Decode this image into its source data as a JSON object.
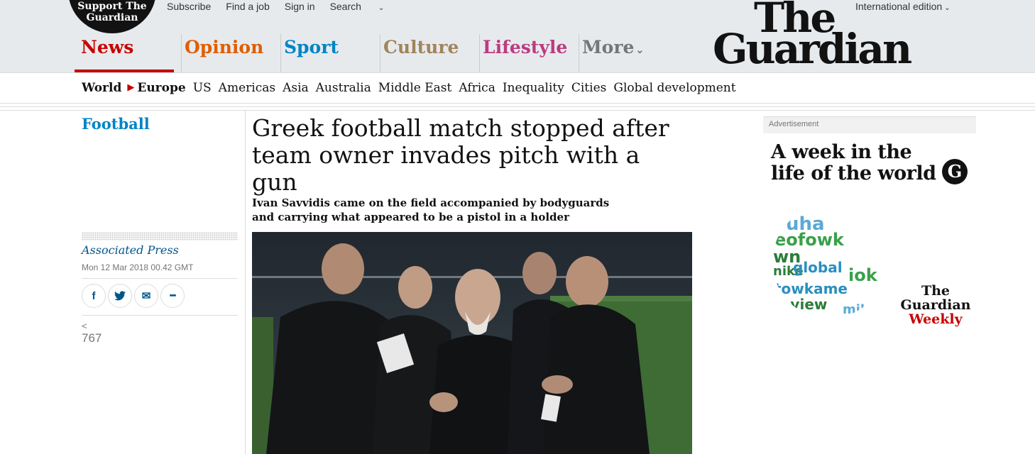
{
  "support": {
    "line1": "Support The",
    "line2": "Guardian"
  },
  "toplinks": [
    {
      "label": "Subscribe"
    },
    {
      "label": "Find a job"
    },
    {
      "label": "Sign in"
    },
    {
      "label": "Search"
    }
  ],
  "edition": "International edition",
  "logo": {
    "line1": "The",
    "line2": "Guardian"
  },
  "pillars": [
    {
      "label": "News",
      "color": "#c70000"
    },
    {
      "label": "Opinion",
      "color": "#e05e00"
    },
    {
      "label": "Sport",
      "color": "#0084c6"
    },
    {
      "label": "Culture",
      "color": "#a1845c"
    },
    {
      "label": "Lifestyle",
      "color": "#bb3b80"
    },
    {
      "label": "More",
      "color": "#767676"
    }
  ],
  "subnav": {
    "parent": "World",
    "current": "Europe",
    "items": [
      "US",
      "Americas",
      "Asia",
      "Australia",
      "Middle East",
      "Africa",
      "Inequality",
      "Cities",
      "Global development"
    ]
  },
  "article": {
    "section": "Football",
    "headline": "Greek football match stopped after team owner invades pitch with a gun",
    "standfirst": "Ivan Savvidis came on the field accompanied by bodyguards and carrying what appeared to be a pistol in a holder",
    "byline": "Associated Press",
    "date": "Mon 12 Mar 2018 00.42 GMT",
    "share_count": "767"
  },
  "share_buttons": [
    {
      "icon": "facebook-icon",
      "glyph": "f"
    },
    {
      "icon": "twitter-icon",
      "glyph": "t"
    },
    {
      "icon": "email-icon",
      "glyph": "✉"
    },
    {
      "icon": "more-icon",
      "glyph": "•••"
    }
  ],
  "ad": {
    "label": "Advertisement",
    "headline": "A week in the life of the world",
    "brand_line1": "The Guardian",
    "brand_line2": "Weekly",
    "cloud_words": [
      "uha",
      "eofowk",
      "wn",
      "nike",
      "global",
      "iok",
      "towkame",
      "ieview",
      "mik"
    ]
  }
}
